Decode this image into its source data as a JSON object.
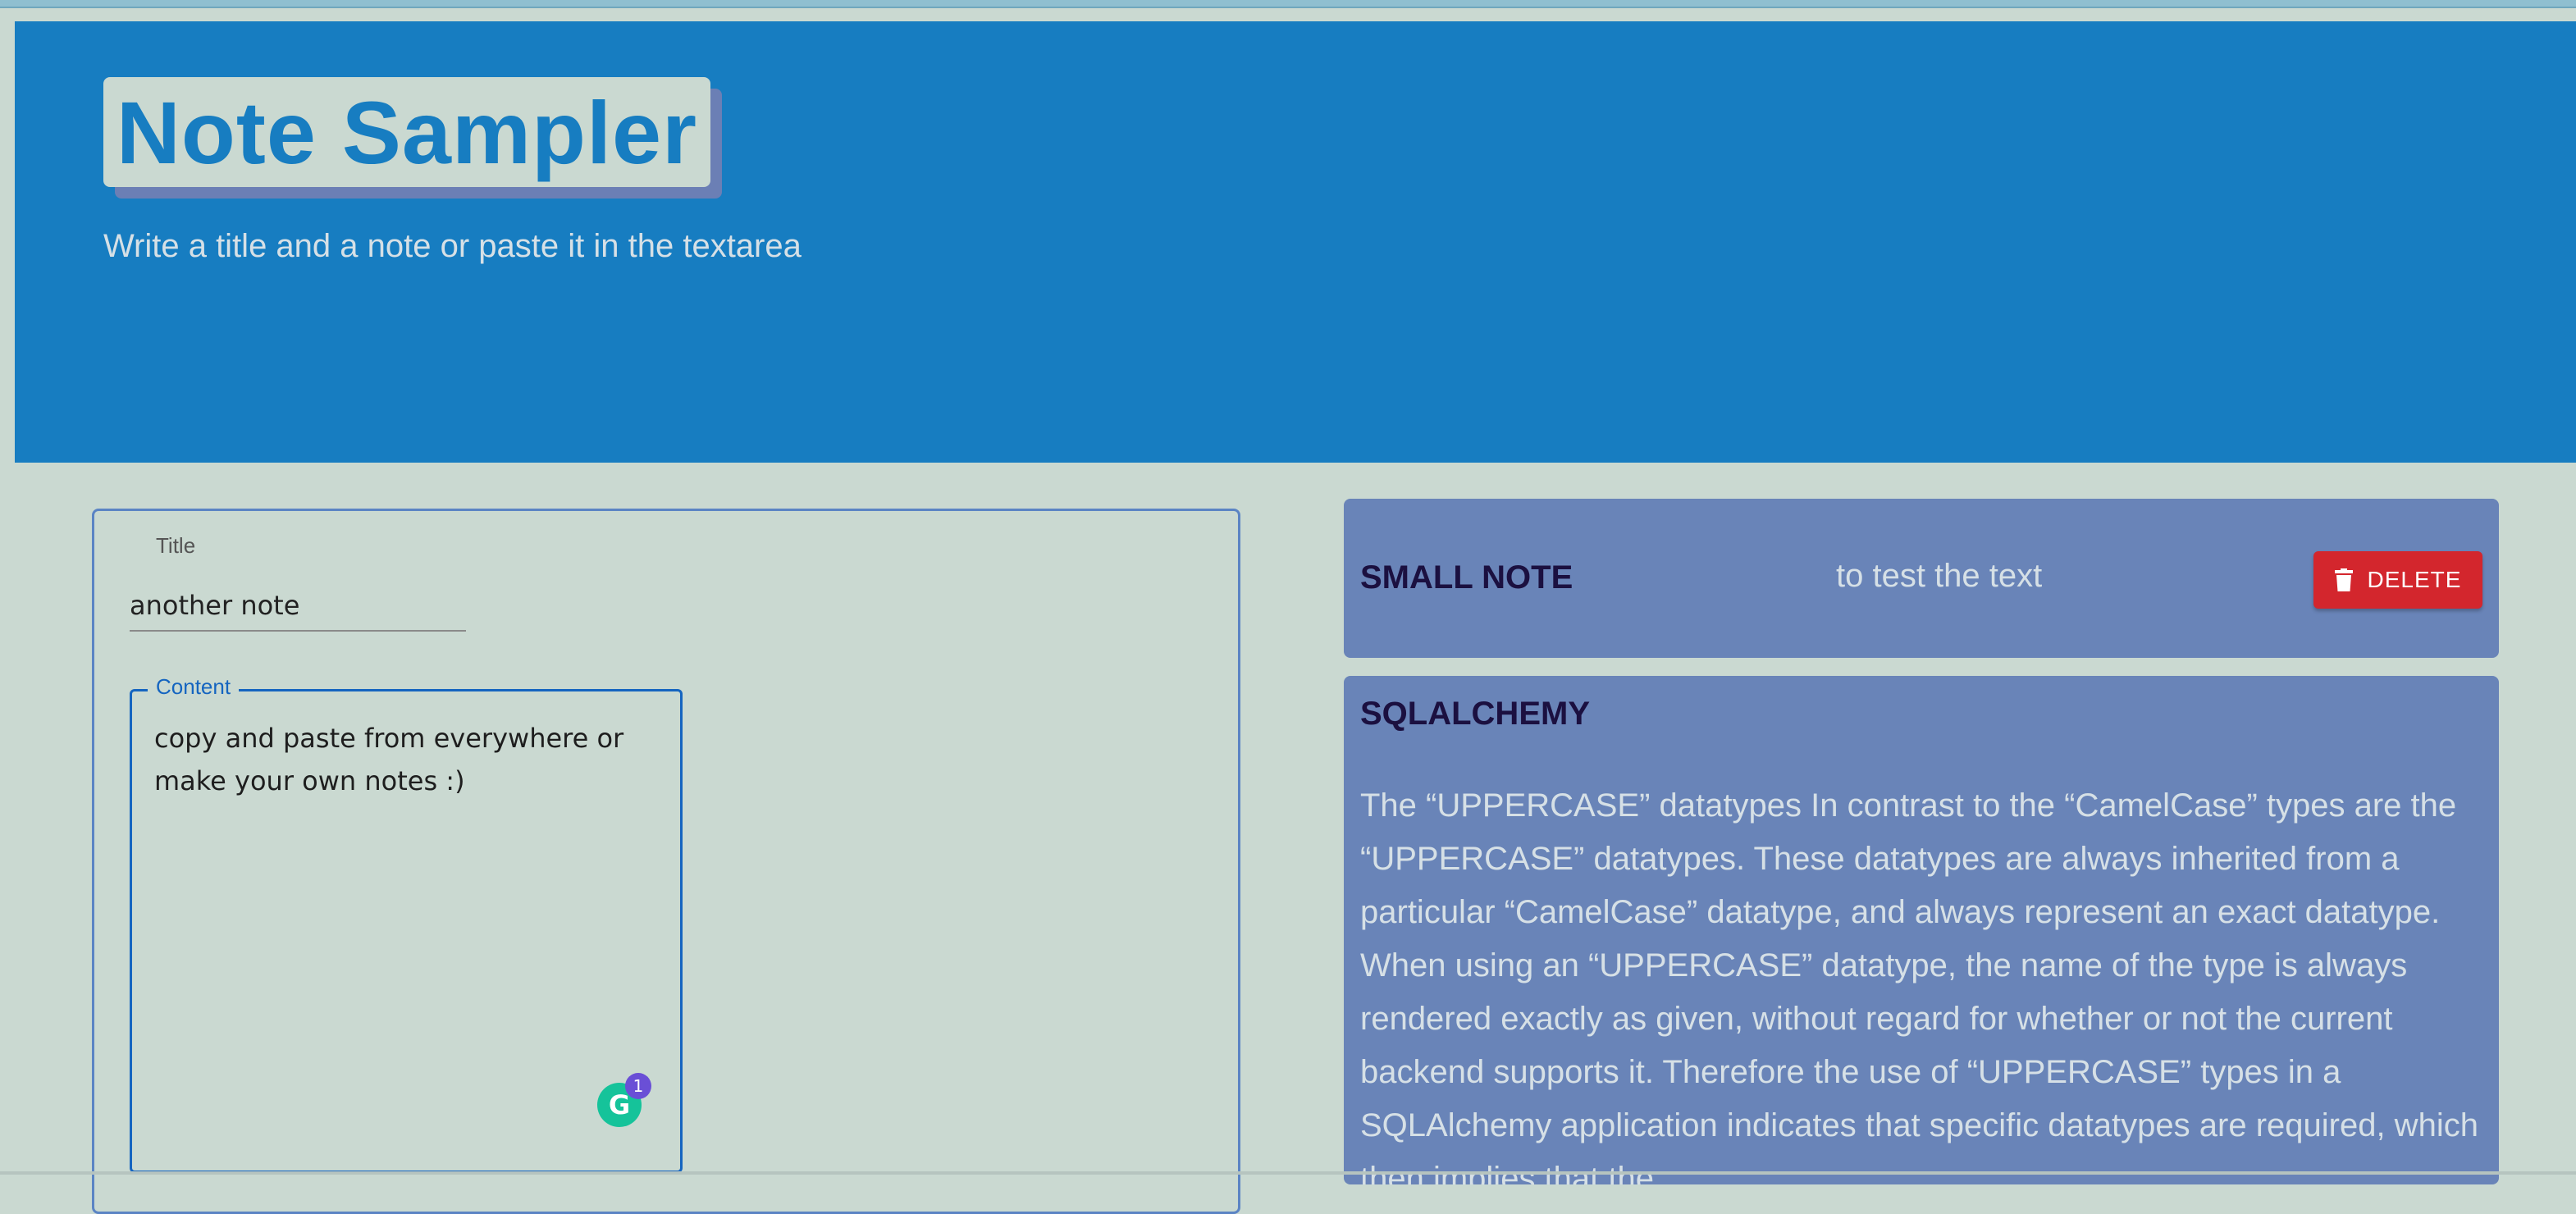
{
  "header": {
    "title": "Note Sampler",
    "subtitle": "Write a title and a note or paste it in the textarea"
  },
  "form": {
    "title_label": "Title",
    "title_value": "another note",
    "content_label": "Content",
    "content_value": "copy and paste from everywhere or make your own notes :)",
    "grammarly_icon": "G",
    "grammarly_count": "1"
  },
  "notes": [
    {
      "title": "SMALL NOTE",
      "content": "to test the text",
      "delete_label": "DELETE"
    },
    {
      "title": "SQLALCHEMY",
      "content": "The “UPPERCASE” datatypes In contrast to the “CamelCase” types are the “UPPERCASE” datatypes. These datatypes are always inherited from a particular “CamelCase” datatype, and always represent an exact datatype. When using an “UPPERCASE” datatype, the name of the type is always rendered exactly as given, without regard for whether or not the current backend supports it. Therefore the use of “UPPERCASE” types in a SQLAlchemy application indicates that specific datatypes are required, which then implies that the"
    }
  ],
  "colors": {
    "header_bg": "#177dc1",
    "page_bg": "#cad9d1",
    "note_bg": "#6984b8",
    "delete_bg": "#d3262d",
    "accent_border": "#1565c0"
  }
}
